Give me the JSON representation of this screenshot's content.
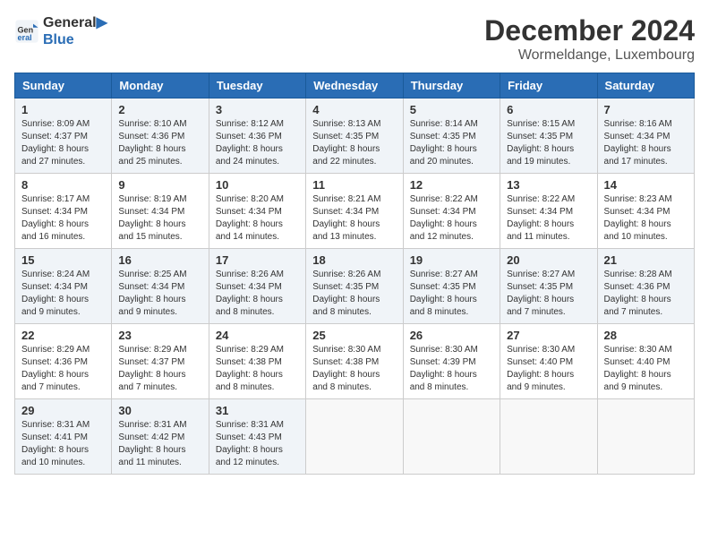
{
  "header": {
    "logo_line1": "General",
    "logo_line2": "Blue",
    "title": "December 2024",
    "subtitle": "Wormeldange, Luxembourg"
  },
  "days_of_week": [
    "Sunday",
    "Monday",
    "Tuesday",
    "Wednesday",
    "Thursday",
    "Friday",
    "Saturday"
  ],
  "weeks": [
    [
      {
        "day": "1",
        "sunrise": "Sunrise: 8:09 AM",
        "sunset": "Sunset: 4:37 PM",
        "daylight": "Daylight: 8 hours and 27 minutes."
      },
      {
        "day": "2",
        "sunrise": "Sunrise: 8:10 AM",
        "sunset": "Sunset: 4:36 PM",
        "daylight": "Daylight: 8 hours and 25 minutes."
      },
      {
        "day": "3",
        "sunrise": "Sunrise: 8:12 AM",
        "sunset": "Sunset: 4:36 PM",
        "daylight": "Daylight: 8 hours and 24 minutes."
      },
      {
        "day": "4",
        "sunrise": "Sunrise: 8:13 AM",
        "sunset": "Sunset: 4:35 PM",
        "daylight": "Daylight: 8 hours and 22 minutes."
      },
      {
        "day": "5",
        "sunrise": "Sunrise: 8:14 AM",
        "sunset": "Sunset: 4:35 PM",
        "daylight": "Daylight: 8 hours and 20 minutes."
      },
      {
        "day": "6",
        "sunrise": "Sunrise: 8:15 AM",
        "sunset": "Sunset: 4:35 PM",
        "daylight": "Daylight: 8 hours and 19 minutes."
      },
      {
        "day": "7",
        "sunrise": "Sunrise: 8:16 AM",
        "sunset": "Sunset: 4:34 PM",
        "daylight": "Daylight: 8 hours and 17 minutes."
      }
    ],
    [
      {
        "day": "8",
        "sunrise": "Sunrise: 8:17 AM",
        "sunset": "Sunset: 4:34 PM",
        "daylight": "Daylight: 8 hours and 16 minutes."
      },
      {
        "day": "9",
        "sunrise": "Sunrise: 8:19 AM",
        "sunset": "Sunset: 4:34 PM",
        "daylight": "Daylight: 8 hours and 15 minutes."
      },
      {
        "day": "10",
        "sunrise": "Sunrise: 8:20 AM",
        "sunset": "Sunset: 4:34 PM",
        "daylight": "Daylight: 8 hours and 14 minutes."
      },
      {
        "day": "11",
        "sunrise": "Sunrise: 8:21 AM",
        "sunset": "Sunset: 4:34 PM",
        "daylight": "Daylight: 8 hours and 13 minutes."
      },
      {
        "day": "12",
        "sunrise": "Sunrise: 8:22 AM",
        "sunset": "Sunset: 4:34 PM",
        "daylight": "Daylight: 8 hours and 12 minutes."
      },
      {
        "day": "13",
        "sunrise": "Sunrise: 8:22 AM",
        "sunset": "Sunset: 4:34 PM",
        "daylight": "Daylight: 8 hours and 11 minutes."
      },
      {
        "day": "14",
        "sunrise": "Sunrise: 8:23 AM",
        "sunset": "Sunset: 4:34 PM",
        "daylight": "Daylight: 8 hours and 10 minutes."
      }
    ],
    [
      {
        "day": "15",
        "sunrise": "Sunrise: 8:24 AM",
        "sunset": "Sunset: 4:34 PM",
        "daylight": "Daylight: 8 hours and 9 minutes."
      },
      {
        "day": "16",
        "sunrise": "Sunrise: 8:25 AM",
        "sunset": "Sunset: 4:34 PM",
        "daylight": "Daylight: 8 hours and 9 minutes."
      },
      {
        "day": "17",
        "sunrise": "Sunrise: 8:26 AM",
        "sunset": "Sunset: 4:34 PM",
        "daylight": "Daylight: 8 hours and 8 minutes."
      },
      {
        "day": "18",
        "sunrise": "Sunrise: 8:26 AM",
        "sunset": "Sunset: 4:35 PM",
        "daylight": "Daylight: 8 hours and 8 minutes."
      },
      {
        "day": "19",
        "sunrise": "Sunrise: 8:27 AM",
        "sunset": "Sunset: 4:35 PM",
        "daylight": "Daylight: 8 hours and 8 minutes."
      },
      {
        "day": "20",
        "sunrise": "Sunrise: 8:27 AM",
        "sunset": "Sunset: 4:35 PM",
        "daylight": "Daylight: 8 hours and 7 minutes."
      },
      {
        "day": "21",
        "sunrise": "Sunrise: 8:28 AM",
        "sunset": "Sunset: 4:36 PM",
        "daylight": "Daylight: 8 hours and 7 minutes."
      }
    ],
    [
      {
        "day": "22",
        "sunrise": "Sunrise: 8:29 AM",
        "sunset": "Sunset: 4:36 PM",
        "daylight": "Daylight: 8 hours and 7 minutes."
      },
      {
        "day": "23",
        "sunrise": "Sunrise: 8:29 AM",
        "sunset": "Sunset: 4:37 PM",
        "daylight": "Daylight: 8 hours and 7 minutes."
      },
      {
        "day": "24",
        "sunrise": "Sunrise: 8:29 AM",
        "sunset": "Sunset: 4:38 PM",
        "daylight": "Daylight: 8 hours and 8 minutes."
      },
      {
        "day": "25",
        "sunrise": "Sunrise: 8:30 AM",
        "sunset": "Sunset: 4:38 PM",
        "daylight": "Daylight: 8 hours and 8 minutes."
      },
      {
        "day": "26",
        "sunrise": "Sunrise: 8:30 AM",
        "sunset": "Sunset: 4:39 PM",
        "daylight": "Daylight: 8 hours and 8 minutes."
      },
      {
        "day": "27",
        "sunrise": "Sunrise: 8:30 AM",
        "sunset": "Sunset: 4:40 PM",
        "daylight": "Daylight: 8 hours and 9 minutes."
      },
      {
        "day": "28",
        "sunrise": "Sunrise: 8:30 AM",
        "sunset": "Sunset: 4:40 PM",
        "daylight": "Daylight: 8 hours and 9 minutes."
      }
    ],
    [
      {
        "day": "29",
        "sunrise": "Sunrise: 8:31 AM",
        "sunset": "Sunset: 4:41 PM",
        "daylight": "Daylight: 8 hours and 10 minutes."
      },
      {
        "day": "30",
        "sunrise": "Sunrise: 8:31 AM",
        "sunset": "Sunset: 4:42 PM",
        "daylight": "Daylight: 8 hours and 11 minutes."
      },
      {
        "day": "31",
        "sunrise": "Sunrise: 8:31 AM",
        "sunset": "Sunset: 4:43 PM",
        "daylight": "Daylight: 8 hours and 12 minutes."
      },
      null,
      null,
      null,
      null
    ]
  ]
}
